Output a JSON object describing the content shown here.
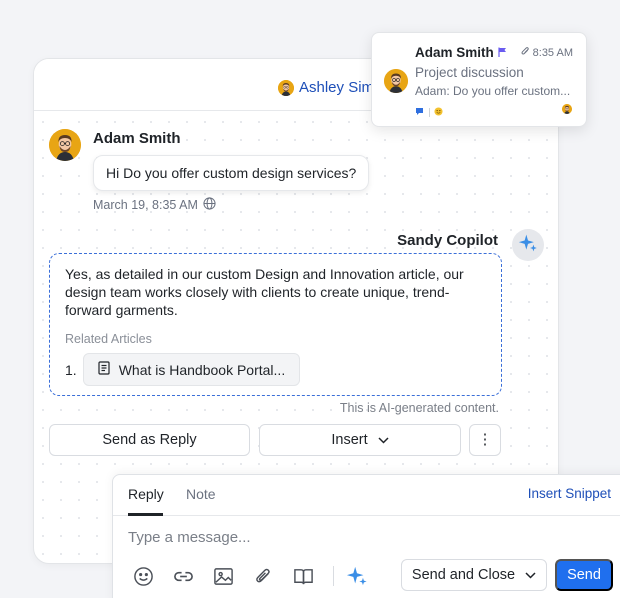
{
  "header": {
    "user_name": "Ashley Simp"
  },
  "message": {
    "sender": "Adam Smith",
    "text": "Hi Do you offer custom design services?",
    "timestamp": "March 19, 8:35 AM"
  },
  "copilot": {
    "name": "Sandy Copilot",
    "response": "Yes, as detailed in our custom Design and Innovation article, our design team works closely with clients to create unique, trend-forward garments.",
    "related_label": "Related Articles",
    "articles": [
      {
        "number": "1.",
        "title": "What is Handbook Portal..."
      }
    ],
    "ai_note": "This is AI-generated content."
  },
  "actions": {
    "send_as_reply": "Send as Reply",
    "insert": "Insert",
    "more": "⋮"
  },
  "notification": {
    "name": "Adam Smith",
    "time": "8:35 AM",
    "subject": "Project discussion",
    "preview": "Adam: Do you offer custom..."
  },
  "composer": {
    "tab_reply": "Reply",
    "tab_note": "Note",
    "insert_snippet": "Insert Snippet",
    "placeholder": "Type a message...",
    "send_and_close": "Send and Close",
    "send": "Send"
  },
  "colors": {
    "accent": "#1e4fb8",
    "send_button": "#1f6fee",
    "avatar_bg": "#e8a514",
    "flag": "#6a5cf0",
    "ai_border": "#3b6fd8"
  },
  "icons": {
    "globe": "globe-icon",
    "sparkle": "sparkle-icon",
    "document": "document-icon",
    "chevron": "chevron-down-icon",
    "flag": "flag-icon",
    "attachment": "paperclip-icon",
    "toolbar": [
      "emoji-icon",
      "link-icon",
      "image-icon",
      "paperclip-icon",
      "book-icon",
      "sparkle-icon"
    ]
  }
}
